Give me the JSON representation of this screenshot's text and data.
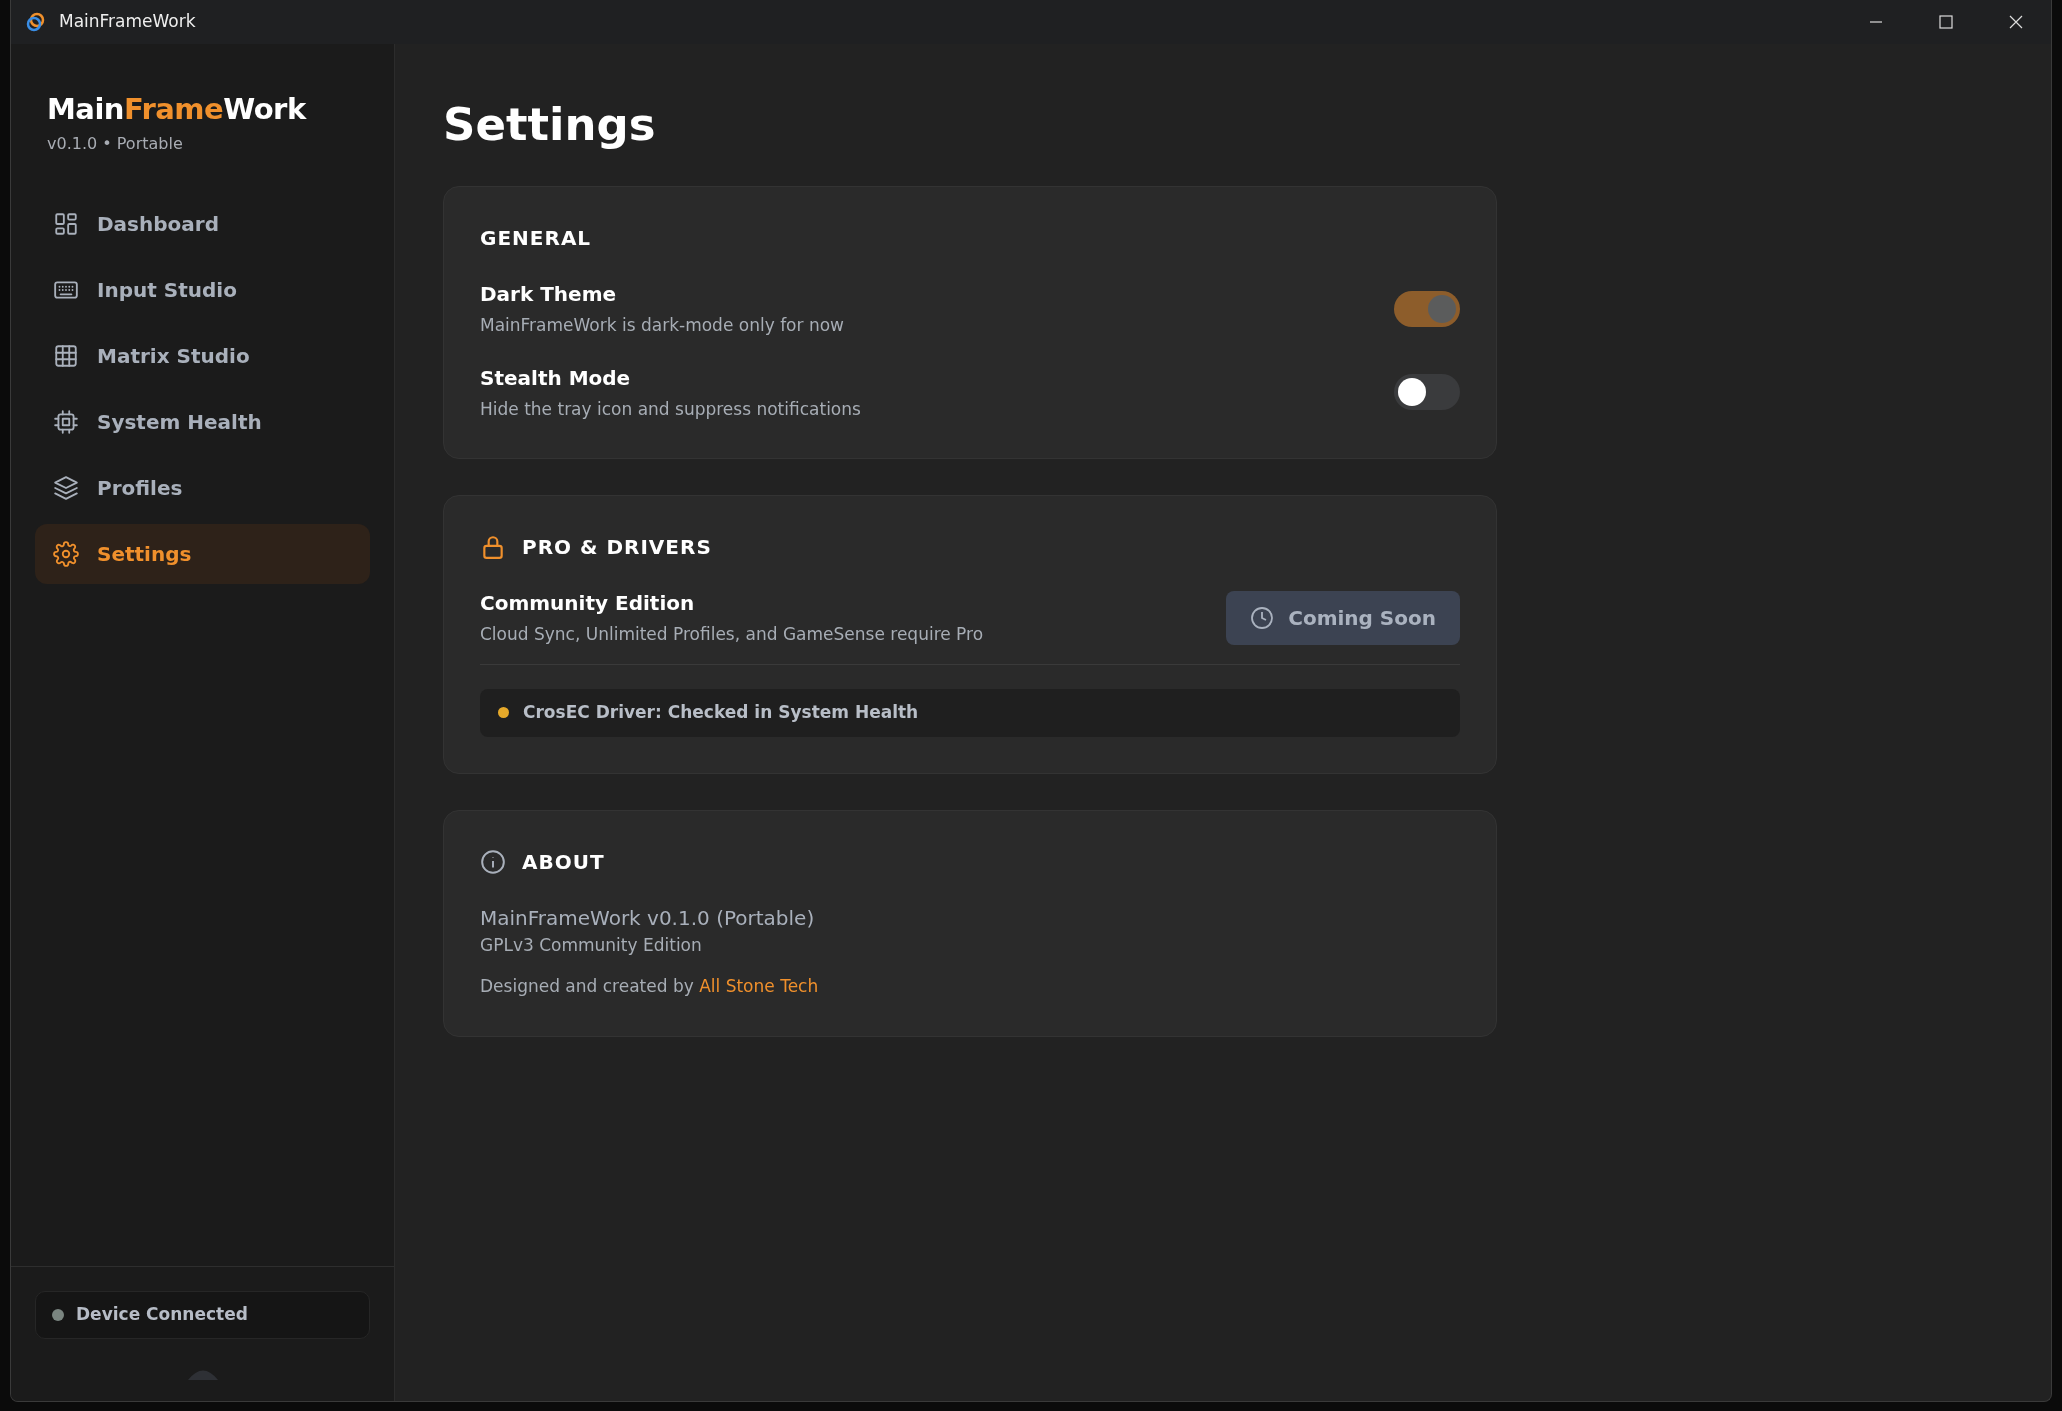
{
  "window": {
    "title": "MainFrameWork"
  },
  "sidebar": {
    "brand": [
      {
        "text": "Main",
        "accent": false
      },
      {
        "text": "Frame",
        "accent": true
      },
      {
        "text": "Work",
        "accent": false
      }
    ],
    "version": "v0.1.0 • Portable",
    "items": [
      {
        "label": "Dashboard",
        "selected": false
      },
      {
        "label": "Input Studio",
        "selected": false
      },
      {
        "label": "Matrix Studio",
        "selected": false
      },
      {
        "label": "System Health",
        "selected": false
      },
      {
        "label": "Profiles",
        "selected": false
      },
      {
        "label": "Settings",
        "selected": true
      }
    ],
    "status": "Device Connected"
  },
  "page_title": "Settings",
  "general": {
    "title": "GENERAL",
    "toggles": [
      {
        "label": "Dark Theme",
        "description": "MainFrameWork is dark-mode only for now",
        "on": true,
        "disabled": true
      },
      {
        "label": "Stealth Mode",
        "description": "Hide the tray icon and suppress notifications",
        "on": false,
        "disabled": false
      }
    ]
  },
  "pro": {
    "title": "PRO & DRIVERS",
    "edition": "Community Edition",
    "description": "Cloud Sync, Unlimited Profiles, and GameSense require Pro",
    "button": {
      "label": "Coming Soon",
      "disabled": true
    },
    "driver": {
      "text": "CrosEC Driver: Checked in System Health",
      "color": "#e6a92a"
    }
  },
  "about": {
    "title": "ABOUT",
    "name": "MainFrameWork v0.1.0 (Portable)",
    "license": "GPLv3 Community Edition",
    "credit": "Designed and created by ",
    "link": "All Stone Tech"
  }
}
